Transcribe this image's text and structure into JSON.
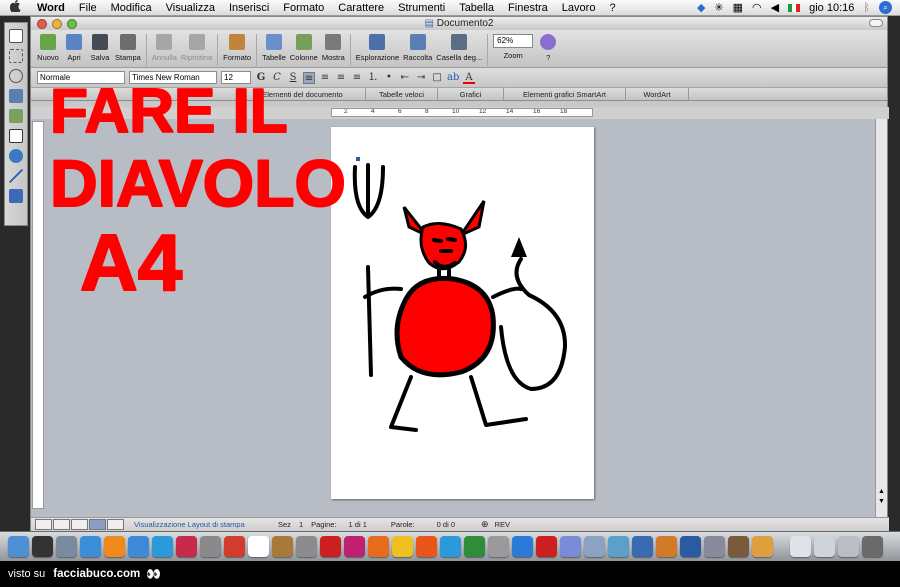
{
  "menubar": {
    "apple": "",
    "items": [
      "Word",
      "File",
      "Modifica",
      "Visualizza",
      "Inserisci",
      "Formato",
      "Carattere",
      "Strumenti",
      "Tabella",
      "Finestra",
      "Lavoro",
      "?"
    ],
    "clock": "gio 10:16"
  },
  "window": {
    "title": "Documento2"
  },
  "toolbar": {
    "buttons": [
      {
        "label": "Nuovo",
        "icon": "new-document-icon",
        "color": "#6aa44a",
        "enabled": true
      },
      {
        "label": "Apri",
        "icon": "open-folder-icon",
        "color": "#5a84c6",
        "enabled": true
      },
      {
        "label": "Salva",
        "icon": "floppy-disk-icon",
        "color": "#444b57",
        "enabled": true
      },
      {
        "label": "Stampa",
        "icon": "printer-icon",
        "color": "#6d6d6d",
        "enabled": true
      },
      {
        "label": "Annulla",
        "icon": "undo-icon",
        "color": "#a6a6a6",
        "enabled": false
      },
      {
        "label": "Ripristina",
        "icon": "redo-icon",
        "color": "#a6a6a6",
        "enabled": false
      },
      {
        "label": "Formato",
        "icon": "format-painter-icon",
        "color": "#c0843a",
        "enabled": true
      },
      {
        "label": "Tabelle",
        "icon": "table-icon",
        "color": "#6a8fc9",
        "enabled": true
      },
      {
        "label": "Colonne",
        "icon": "columns-icon",
        "color": "#74a057",
        "enabled": true
      },
      {
        "label": "Mostra",
        "icon": "pilcrow-icon",
        "color": "#7a7a7a",
        "enabled": true
      },
      {
        "label": "Esplorazione",
        "icon": "navigation-pane-icon",
        "color": "#4f6fa8",
        "enabled": true
      },
      {
        "label": "Raccolta",
        "icon": "gallery-icon",
        "color": "#5b7fb2",
        "enabled": true
      },
      {
        "label": "Casella deg...",
        "icon": "toolbox-icon",
        "color": "#5c6d85",
        "enabled": true
      }
    ],
    "zoom": {
      "label": "Zoom",
      "value": "62%"
    },
    "help_label": "?"
  },
  "format_bar": {
    "style": "Normale",
    "font": "Times New Roman",
    "size": "12",
    "bold": "G",
    "italic": "C",
    "underline": "S",
    "font_color_label": "A"
  },
  "gallery_tabs": [
    "Elementi del documento",
    "Tabelle veloci",
    "Grafici",
    "Elementi grafici SmartArt",
    "WordArt"
  ],
  "ruler": {
    "ticks": [
      "2",
      "4",
      "6",
      "8",
      "10",
      "12",
      "14",
      "16",
      "18"
    ]
  },
  "statusbar": {
    "view_name": "Visualizzazione Layout di stampa",
    "section_label": "Sez",
    "section_value": "1",
    "pages_label": "Pagine:",
    "pages_value": "1 di 1",
    "words_label": "Parole:",
    "words_value": "0 di 0",
    "rev": "REV"
  },
  "overlay_text": {
    "line1": "FARE IL",
    "line2": "DIAVOLO",
    "line3": "A4",
    "color": "#ff0000"
  },
  "drawing": {
    "devil_color": "#ff0000",
    "ink_color": "#000000"
  },
  "dock": {
    "icons": [
      {
        "name": "finder-icon",
        "color": "#4e8fd6"
      },
      {
        "name": "dashboard-icon",
        "color": "#333333"
      },
      {
        "name": "mail-icon",
        "color": "#7a8aa0"
      },
      {
        "name": "safari-icon",
        "color": "#3b8fd9"
      },
      {
        "name": "vlc-icon",
        "color": "#f08a1c"
      },
      {
        "name": "itunes-icon",
        "color": "#3f8ad8"
      },
      {
        "name": "skype-icon",
        "color": "#2a9ad8"
      },
      {
        "name": "app-m-icon",
        "color": "#c82b4a"
      },
      {
        "name": "preview-icon",
        "color": "#8a8a8a"
      },
      {
        "name": "ical-icon",
        "color": "#d33b2c"
      },
      {
        "name": "itunes-2-icon",
        "color": "#ffffff"
      },
      {
        "name": "turtle-icon",
        "color": "#a87a3a"
      },
      {
        "name": "acrobat-icon",
        "color": "#8c8c8c"
      },
      {
        "name": "pdf-icon",
        "color": "#cc2020"
      },
      {
        "name": "indesign-icon",
        "color": "#c02070"
      },
      {
        "name": "burn-icon",
        "color": "#e66b1c"
      },
      {
        "name": "sun-icon",
        "color": "#f0c020"
      },
      {
        "name": "firefox-icon",
        "color": "#e8561c"
      },
      {
        "name": "skype-2-icon",
        "color": "#2a9ad8"
      },
      {
        "name": "earth-icon",
        "color": "#2f8d3a"
      },
      {
        "name": "script-icon",
        "color": "#9a9a9a"
      },
      {
        "name": "app-s-icon",
        "color": "#2a7ad8"
      },
      {
        "name": "app-s-2-icon",
        "color": "#cc2020"
      },
      {
        "name": "network-icon",
        "color": "#7a8bd8"
      },
      {
        "name": "folder-icon",
        "color": "#8ba3c3"
      },
      {
        "name": "wave-icon",
        "color": "#5aa0c8"
      },
      {
        "name": "app-x-icon",
        "color": "#3a6ab0"
      },
      {
        "name": "photo-icon",
        "color": "#d07a2a"
      },
      {
        "name": "xcode-icon",
        "color": "#2a5aa0"
      },
      {
        "name": "system-preferences-icon",
        "color": "#8a8a9a"
      },
      {
        "name": "library-icon",
        "color": "#7a5a3a"
      },
      {
        "name": "paint-icon",
        "color": "#e0a040"
      },
      {
        "name": "document-icon",
        "color": "#dfe3e8"
      },
      {
        "name": "window-icon",
        "color": "#cfd4da"
      },
      {
        "name": "grid-icon",
        "color": "#b9bec5"
      },
      {
        "name": "trash-icon",
        "color": "#6a6a6a"
      }
    ]
  },
  "footer": {
    "prefix": "visto su",
    "site": "facciabuco.com"
  }
}
